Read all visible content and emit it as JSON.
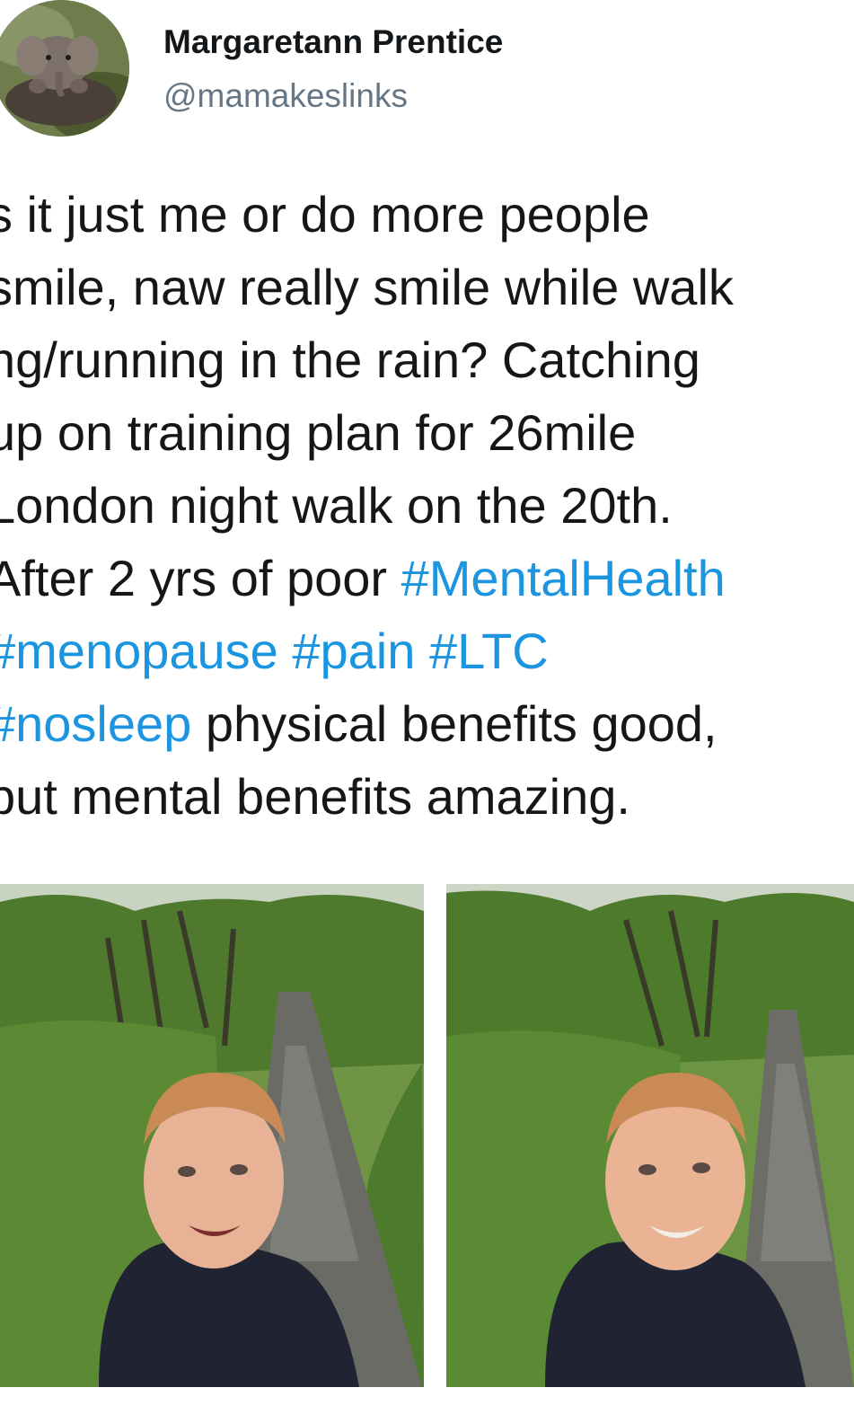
{
  "author": {
    "display_name": "Margaretann Prentice",
    "handle": "@mamakeslinks",
    "avatar_icon": "elephant-avatar"
  },
  "tweet": {
    "lines": [
      [
        {
          "text": "s it  just me or do more people",
          "type": "text"
        }
      ],
      [
        {
          "text": "smile, naw really smile while walk",
          "type": "text"
        }
      ],
      [
        {
          "text": "ng/running in the rain? Catching",
          "type": "text"
        }
      ],
      [
        {
          "text": "up on training plan for 26mile",
          "type": "text"
        }
      ],
      [
        {
          "text": "London night walk on the 20th.",
          "type": "text"
        }
      ],
      [
        {
          "text": "After 2 yrs of poor ",
          "type": "text"
        },
        {
          "text": "#MentalHealth",
          "type": "hashtag"
        }
      ],
      [
        {
          "text": "#menopause",
          "type": "hashtag"
        },
        {
          "text": " ",
          "type": "text"
        },
        {
          "text": "#pain",
          "type": "hashtag"
        },
        {
          "text": " ",
          "type": "text"
        },
        {
          "text": "#LTC",
          "type": "hashtag"
        }
      ],
      [
        {
          "text": "#nosleep",
          "type": "hashtag"
        },
        {
          "text": " physical benefits good,",
          "type": "text"
        }
      ],
      [
        {
          "text": "but mental benefits amazing.",
          "type": "text"
        }
      ]
    ]
  },
  "media": [
    {
      "name": "photo-selfie-rain-path-1"
    },
    {
      "name": "photo-selfie-rain-path-2"
    }
  ],
  "colors": {
    "text": "#14171a",
    "secondary": "#657786",
    "hashtag": "#1b95e0",
    "background": "#ffffff"
  }
}
